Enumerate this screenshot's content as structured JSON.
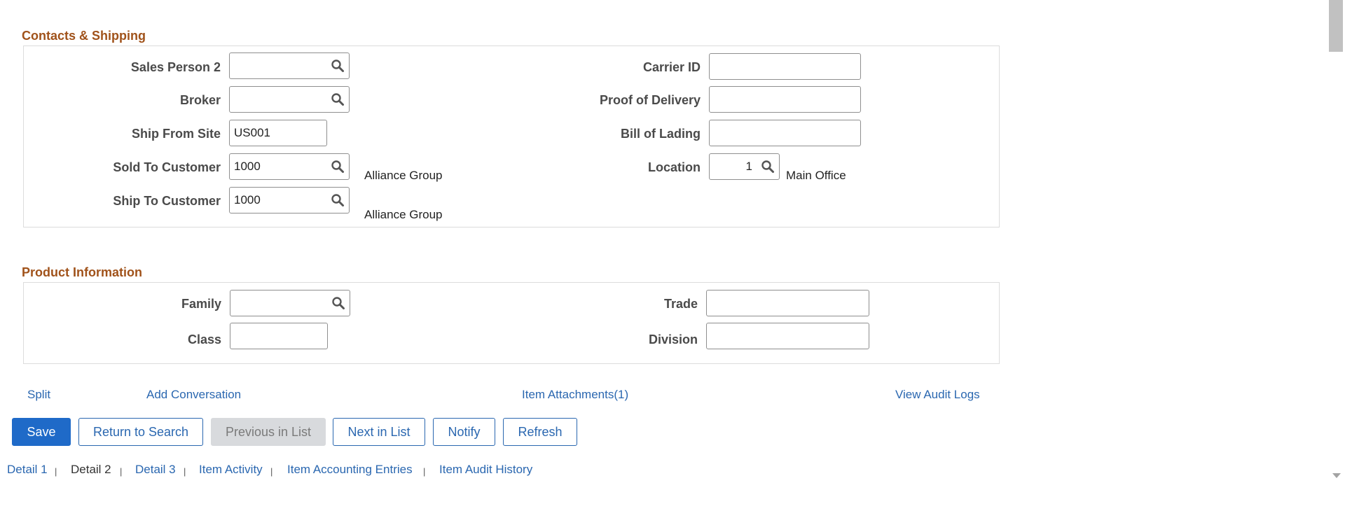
{
  "contacts": {
    "title": "Contacts & Shipping",
    "sales_person2": {
      "label": "Sales Person 2",
      "value": ""
    },
    "broker": {
      "label": "Broker",
      "value": ""
    },
    "ship_from_site": {
      "label": "Ship From Site",
      "value": "US001"
    },
    "sold_to_customer": {
      "label": "Sold To Customer",
      "value": "1000",
      "desc": "Alliance Group"
    },
    "ship_to_customer": {
      "label": "Ship To Customer",
      "value": "1000",
      "desc": "Alliance Group"
    },
    "carrier_id": {
      "label": "Carrier ID",
      "value": ""
    },
    "proof_of_delivery": {
      "label": "Proof of Delivery",
      "value": ""
    },
    "bill_of_lading": {
      "label": "Bill of Lading",
      "value": ""
    },
    "location": {
      "label": "Location",
      "value": "1",
      "desc": "Main Office"
    }
  },
  "product": {
    "title": "Product Information",
    "family": {
      "label": "Family",
      "value": ""
    },
    "class": {
      "label": "Class",
      "value": ""
    },
    "trade": {
      "label": "Trade",
      "value": ""
    },
    "division": {
      "label": "Division",
      "value": ""
    }
  },
  "links": {
    "split": "Split",
    "add_conversation": "Add Conversation",
    "item_attachments": "Item Attachments(1)",
    "view_audit_logs": "View Audit Logs"
  },
  "buttons": {
    "save": "Save",
    "return_to_search": "Return to Search",
    "previous_in_list": "Previous in List",
    "next_in_list": "Next in List",
    "notify": "Notify",
    "refresh": "Refresh"
  },
  "tabs": {
    "separator": "|",
    "items": [
      "Detail 1",
      "Detail 2",
      "Detail 3",
      "Item Activity",
      "Item Accounting Entries",
      "Item Audit History"
    ],
    "current": "Detail 2"
  },
  "icons": {
    "lookup": "search-icon"
  },
  "colors": {
    "section_title": "#a0521a",
    "link": "#2a67b0",
    "primary": "#1f6ac8"
  }
}
